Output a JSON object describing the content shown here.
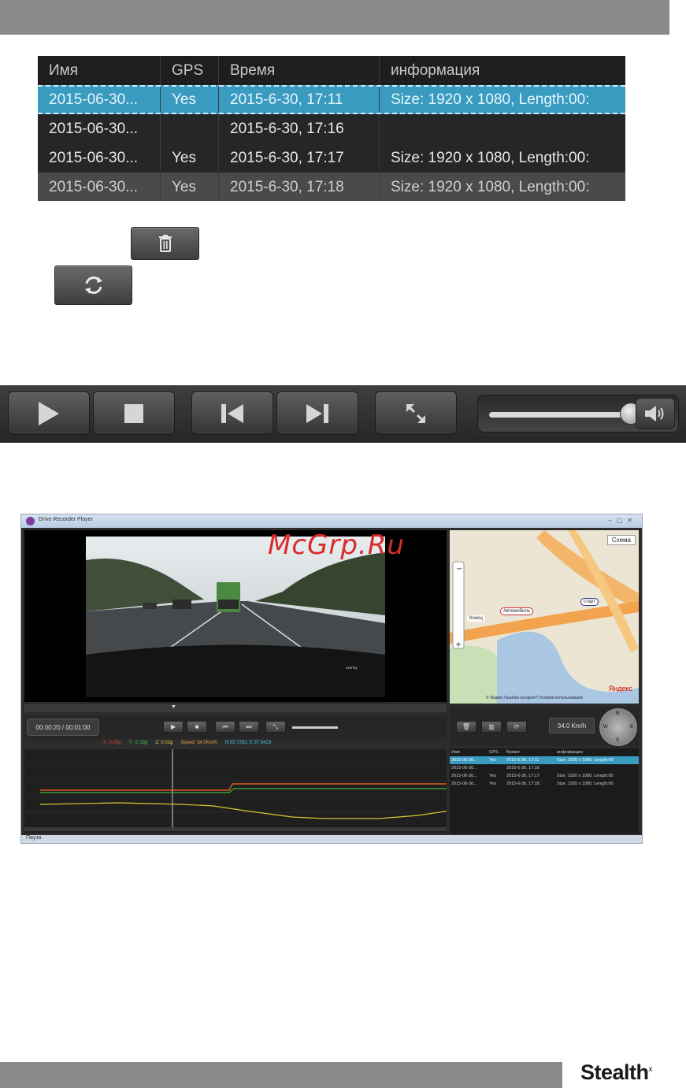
{
  "file_table": {
    "headers": [
      "Имя",
      "GPS",
      "Время",
      "информация"
    ],
    "rows": [
      {
        "name": "2015-06-30...",
        "gps": "Yes",
        "time": "2015-6-30, 17:11",
        "info": "Size: 1920 x 1080, Length:00:"
      },
      {
        "name": "2015-06-30...",
        "gps": "",
        "time": "2015-6-30, 17:16",
        "info": ""
      },
      {
        "name": "2015-06-30...",
        "gps": "Yes",
        "time": "2015-6-30, 17:17",
        "info": "Size: 1920 x 1080, Length:00:"
      },
      {
        "name": "2015-06-30...",
        "gps": "Yes",
        "time": "2015-6-30, 17:18",
        "info": "Size: 1920 x 1080, Length:00:"
      }
    ]
  },
  "icons": {
    "delete": "trash-icon",
    "refresh": "refresh-icon",
    "play": "play-icon",
    "stop": "stop-icon",
    "prev": "previous-icon",
    "next": "next-icon",
    "fullscreen": "fullscreen-icon",
    "volume": "speaker-icon"
  },
  "volume_level": 0.88,
  "app": {
    "title": "Drive Recorder Player",
    "time_display": "00:00:20 / 00:01:00",
    "gsensor": {
      "x": "X: 0.00g",
      "y": "Y: -0.16g",
      "z": "Z: 0.02g",
      "speed": "Speed: 34.0Km/h",
      "coords": "N:55.7283, E:37.5423"
    },
    "status": "Пауза",
    "speed_box": "34.0 Km/h",
    "compass": {
      "n": "N",
      "s": "S",
      "w": "W",
      "e": "E"
    },
    "map": {
      "scheme": "Схема",
      "end_label": "Конец",
      "car_label": "Автомобиль",
      "start_label": "старт",
      "footer": "© Яндекс  Ошибка на карте?  Условия использования",
      "brand": "Яндекс"
    },
    "mini_table": {
      "headers": [
        "Имя",
        "GPS",
        "Время",
        "информация"
      ],
      "rows": [
        {
          "name": "2015-06-30...",
          "gps": "Yes",
          "time": "2015-6-30, 17:11",
          "info": "Size: 1920 x 1080, Length:00"
        },
        {
          "name": "2015-06-30...",
          "gps": "",
          "time": "2015-6-30, 17:16",
          "info": ""
        },
        {
          "name": "2015-06-30...",
          "gps": "Yes",
          "time": "2015-6-30, 17:17",
          "info": "Size: 1920 x 1080, Length:00"
        },
        {
          "name": "2015-06-30...",
          "gps": "Yes",
          "time": "2015-6-30, 17:18",
          "info": "Size: 1920 x 1080, Length:00"
        }
      ]
    }
  },
  "watermark": "McGrp.Ru",
  "brand": {
    "name": "Stealth",
    "mark": "x"
  }
}
